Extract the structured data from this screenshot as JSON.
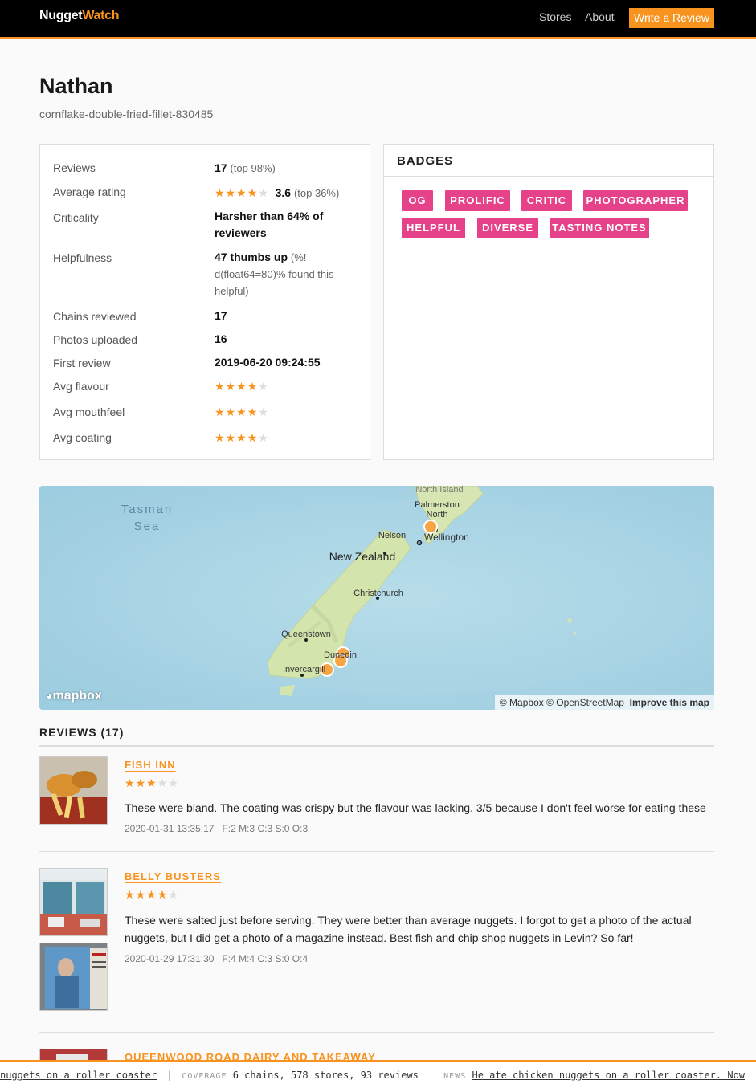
{
  "nav": {
    "brand_part1": "Nugget",
    "brand_part2": "Watch",
    "stores": "Stores",
    "about": "About",
    "write_review": "Write a Review"
  },
  "profile": {
    "name": "Nathan",
    "slug": "cornflake-double-fried-fillet-830485"
  },
  "stats": {
    "reviews_label": "Reviews",
    "reviews_value": "17",
    "reviews_rank": "(top 98%)",
    "avg_rating_label": "Average rating",
    "avg_rating_value": "3.6",
    "avg_rating_rank": "(top 36%)",
    "avg_rating_stars": 4,
    "criticality_label": "Criticality",
    "criticality_value": "Harsher than 64% of reviewers",
    "helpfulness_label": "Helpfulness",
    "helpfulness_value": "47 thumbs up",
    "helpfulness_note": "(%! d(float64=80)% found this helpful)",
    "chains_label": "Chains reviewed",
    "chains_value": "17",
    "photos_label": "Photos uploaded",
    "photos_value": "16",
    "first_label": "First review",
    "first_value": "2019-06-20 09:24:55",
    "flavour_label": "Avg flavour",
    "flavour_stars": 4,
    "mouthfeel_label": "Avg mouthfeel",
    "mouthfeel_stars": 4,
    "coating_label": "Avg coating",
    "coating_stars": 4
  },
  "badges": {
    "title": "BADGES",
    "items": [
      "OG",
      "PROLIFIC",
      "CRITIC",
      "PHOTOGRAPHER",
      "HELPFUL",
      "DIVERSE",
      "TASTING NOTES"
    ],
    "color": "#e6428a"
  },
  "map": {
    "labels": {
      "sea": "Tasman",
      "sea2": "Sea",
      "country": "New Zealand",
      "north_island": "North Island",
      "palmerston": "Palmerston",
      "north": "North",
      "wellington": "Wellington",
      "nelson": "Nelson",
      "christchurch": "Christchurch",
      "queenstown": "Queenstown",
      "dunedin": "Dunedin",
      "invercargill": "Invercargill"
    },
    "logo": "mapbox",
    "attribution": "© Mapbox © OpenStreetMap",
    "improve": "Improve this map"
  },
  "reviews": {
    "heading": "REVIEWS (17)",
    "items": [
      {
        "shop": "FISH INN",
        "stars": 3,
        "text": "These were bland. The coating was crispy but the flavour was lacking. 3/5 because I don't feel worse for eating these",
        "meta": "2020-01-31 13:35:17   F:2 M:3 C:3 S:0 O:3"
      },
      {
        "shop": "BELLY BUSTERS",
        "stars": 4,
        "text": "These were salted just before serving. They were better than average nuggets. I forgot to get a photo of the actual nuggets, but I did get a photo of a magazine instead. Best fish and chip shop nuggets in Levin? So far!",
        "meta": "2020-01-29 17:31:30   F:4 M:4 C:3 S:0 O:4"
      },
      {
        "shop": "QUEENWOOD ROAD DAIRY AND TAKEAWAY"
      }
    ]
  },
  "ticker": {
    "lead": "nuggets on a roller coaster",
    "coverage_tag": "COVERAGE",
    "coverage": "6 chains, 578 stores, 93 reviews",
    "news_tag": "NEWS",
    "news": "He ate chicken nuggets on a roller coaster. Now"
  },
  "colors": {
    "accent": "#f7931e",
    "badge": "#e6428a"
  }
}
